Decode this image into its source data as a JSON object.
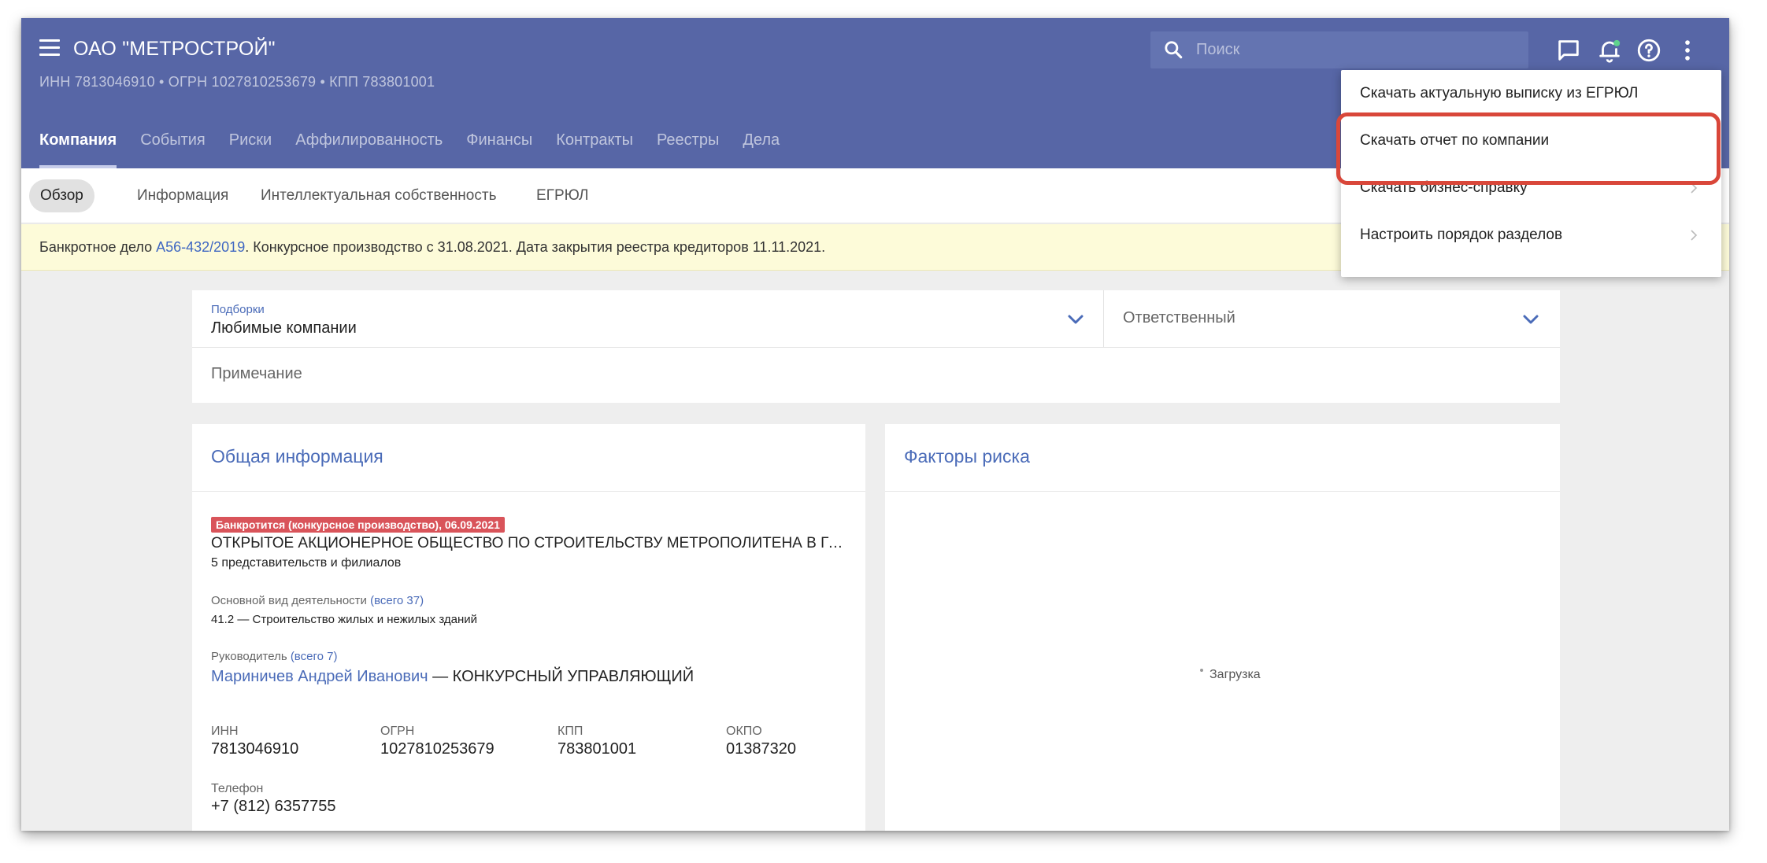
{
  "header": {
    "company_name": "ОАО \"МЕТРОСТРОЙ\"",
    "company_ids": "ИНН 7813046910 • ОГРН 1027810253679 • КПП 783801001",
    "tabs": [
      {
        "label": "Компания"
      },
      {
        "label": "События"
      },
      {
        "label": "Риски"
      },
      {
        "label": "Аффилированность"
      },
      {
        "label": "Финансы"
      },
      {
        "label": "Контракты"
      },
      {
        "label": "Реестры"
      },
      {
        "label": "Дела"
      }
    ],
    "search_placeholder": "Поиск",
    "icons": [
      "search-icon",
      "message-icon",
      "bell-icon",
      "help-icon",
      "more-vertical-icon"
    ]
  },
  "subtabs": [
    {
      "label": "Обзор"
    },
    {
      "label": "Информация"
    },
    {
      "label": "Интеллектуальная собственность"
    },
    {
      "label": "ЕГРЮЛ"
    }
  ],
  "banner": {
    "prefix": "Банкротное дело ",
    "case_link": "А56-432/2019",
    "text": ". Конкурсное производство с 31.08.2021. Дата закрытия реестра кредиторов 11.11.2021."
  },
  "filters": {
    "collections_label": "Подборки",
    "collections_value": "Любимые компании",
    "responsible_placeholder": "Ответственный",
    "note_placeholder": "Примечание"
  },
  "general_info": {
    "title": "Общая информация",
    "badge": "Банкротится (конкурсное производство), 06.09.2021",
    "full_name": "ОТКРЫТОЕ АКЦИОНЕРНОЕ ОБЩЕСТВО ПО СТРОИТЕЛЬСТВУ МЕТРОПОЛИТЕНА В ГОРОДЕ САНКТ-ПЕТЕРБУРГЕ",
    "branches_link": "5 представительств и филиалов",
    "activity_label": "Основной вид деятельности",
    "activity_total": "(всего 37)",
    "activity_value": "41.2 — Строительство жилых и нежилых зданий",
    "head_label": "Руководитель",
    "head_total": "(всего 7)",
    "head_name": "Мариничев Андрей Иванович",
    "head_role": " — КОНКУРСНЫЙ УПРАВЛЯЮЩИЙ",
    "requisites": [
      {
        "label": "ИНН",
        "value": "7813046910"
      },
      {
        "label": "ОГРН",
        "value": "1027810253679"
      },
      {
        "label": "КПП",
        "value": "783801001"
      },
      {
        "label": "ОКПО",
        "value": "01387320"
      }
    ],
    "phone_label": "Телефон",
    "phone_value": "+7 (812) 6357755"
  },
  "risk_factors": {
    "title": "Факторы риска",
    "loading": "Загрузка"
  },
  "dropdown": {
    "items": [
      {
        "label": "Скачать актуальную выписку из ЕГРЮЛ",
        "has_submenu": false
      },
      {
        "label": "Скачать отчет по компании",
        "has_submenu": false
      },
      {
        "label": "Скачать бизнес-справку",
        "has_submenu": true
      },
      {
        "label": "Настроить порядок разделов",
        "has_submenu": true
      }
    ],
    "highlight_color": "#d9473a"
  },
  "colors": {
    "header": "#5766a6",
    "link": "#4a6bb8",
    "badge": "#d9545a",
    "banner": "#fdfbd9"
  }
}
